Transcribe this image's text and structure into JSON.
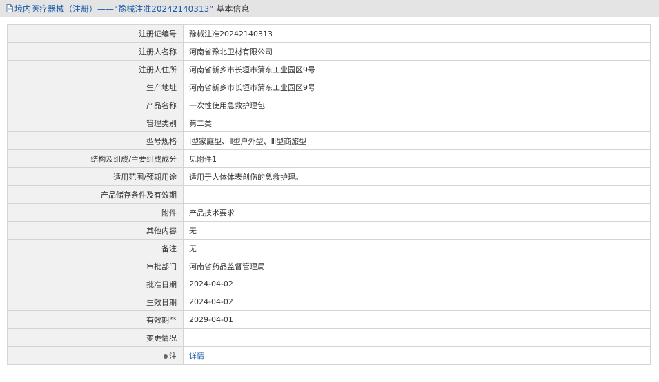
{
  "header": {
    "title_prefix": "境内医疗器械（注册）——“豫械注准20242140313”",
    "title_suffix": "基本信息"
  },
  "rows": [
    {
      "label": "注册证编号",
      "value": "豫械注准20242140313"
    },
    {
      "label": "注册人名称",
      "value": "河南省豫北卫材有限公司"
    },
    {
      "label": "注册人住所",
      "value": "河南省新乡市长垣市蒲东工业园区9号"
    },
    {
      "label": "生产地址",
      "value": "河南省新乡市长垣市蒲东工业园区9号"
    },
    {
      "label": "产品名称",
      "value": "一次性使用急救护理包"
    },
    {
      "label": "管理类别",
      "value": "第二类"
    },
    {
      "label": "型号规格",
      "value": "Ⅰ型家庭型、Ⅱ型户外型、Ⅲ型商旅型"
    },
    {
      "label": "结构及组成/主要组成成分",
      "value": "见附件1"
    },
    {
      "label": "适用范围/预期用途",
      "value": "适用于人体体表创伤的急救护理。"
    },
    {
      "label": "产品储存条件及有效期",
      "value": ""
    },
    {
      "label": "附件",
      "value": "产品技术要求"
    },
    {
      "label": "其他内容",
      "value": "无"
    },
    {
      "label": "备注",
      "value": "无"
    },
    {
      "label": "审批部门",
      "value": "河南省药品监督管理局"
    },
    {
      "label": "批准日期",
      "value": "2024-04-02"
    },
    {
      "label": "生效日期",
      "value": "2024-04-02"
    },
    {
      "label": "有效期至",
      "value": "2029-04-01"
    },
    {
      "label": "变更情况",
      "value": ""
    }
  ],
  "note_row": {
    "label": "注",
    "link_text": "详情"
  },
  "colors": {
    "link": "#1a5aa6",
    "header_bg": "#e4e4e4",
    "label_bg": "#f1f1f1",
    "border": "#d4d4d4"
  }
}
